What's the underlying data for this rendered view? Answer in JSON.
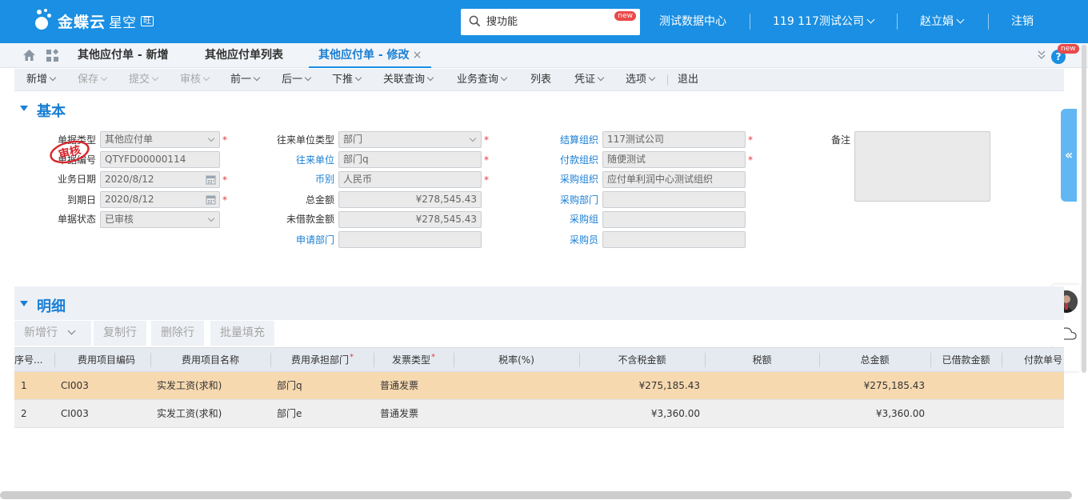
{
  "topbar": {
    "logo_text": "金蝶云",
    "logo_sub": "星空",
    "logo_tag": "旺",
    "search_placeholder": "搜功能",
    "search_badge": "new",
    "data_center": "测试数据中心",
    "company": "119 117测试公司",
    "user": "赵立娟",
    "logout": "注销",
    "brand_color": "#1a8fe3"
  },
  "tabs": [
    {
      "label": "其他应付单 - 新增",
      "active": false
    },
    {
      "label": "其他应付单列表",
      "active": false
    },
    {
      "label": "其他应付单 - 修改",
      "active": true
    }
  ],
  "tab_close": "×",
  "help_badge": "new",
  "help_label": "?",
  "toolbar": {
    "items": [
      {
        "label": "新增",
        "disabled": false
      },
      {
        "label": "保存",
        "disabled": true
      },
      {
        "label": "提交",
        "disabled": true
      },
      {
        "label": "审核",
        "disabled": true
      },
      {
        "label": "前一",
        "disabled": false
      },
      {
        "label": "后一",
        "disabled": false
      },
      {
        "label": "下推",
        "disabled": false
      },
      {
        "label": "关联查询",
        "disabled": false
      },
      {
        "label": "业务查询",
        "disabled": false
      },
      {
        "label": "列表",
        "disabled": false
      },
      {
        "label": "凭证",
        "disabled": false
      },
      {
        "label": "选项",
        "disabled": false
      },
      {
        "label": "退出",
        "disabled": false
      }
    ]
  },
  "basic": {
    "title": "基本",
    "stamp": "审核",
    "col1": {
      "bill_type": {
        "label": "单据类型",
        "value": "其他应付单",
        "required": true
      },
      "bill_no": {
        "label": "单据编号",
        "value": "QTYFD00000114",
        "required": false
      },
      "biz_date": {
        "label": "业务日期",
        "value": "2020/8/12",
        "required": true
      },
      "due_date": {
        "label": "到期日",
        "value": "2020/8/12",
        "required": true
      },
      "status": {
        "label": "单据状态",
        "value": "已审核",
        "required": false
      }
    },
    "col2": {
      "contact_type": {
        "label": "往来单位类型",
        "value": "部门",
        "required": true
      },
      "contact_unit": {
        "label": "往来单位",
        "value": "部门q",
        "required": true
      },
      "currency": {
        "label": "币别",
        "value": "人民币",
        "required": true
      },
      "total": {
        "label": "总金额",
        "value": "¥278,545.43"
      },
      "unborrowed": {
        "label": "未借款金额",
        "value": "¥278,545.43"
      },
      "apply_dept": {
        "label": "申请部门",
        "value": ""
      }
    },
    "col3": {
      "settle_org": {
        "label": "结算组织",
        "value": "117测试公司",
        "required": true
      },
      "pay_org": {
        "label": "付款组织",
        "value": "随便测试",
        "required": true
      },
      "purchase_org": {
        "label": "采购组织",
        "value": "应付单利润中心测试组织"
      },
      "purchase_dept": {
        "label": "采购部门",
        "value": ""
      },
      "purchase_group": {
        "label": "采购组",
        "value": ""
      },
      "purchaser": {
        "label": "采购员",
        "value": ""
      }
    },
    "remark": {
      "label": "备注",
      "value": ""
    }
  },
  "side_collapse": "«",
  "detail": {
    "title": "明细",
    "buttons": [
      {
        "label": "新增行"
      },
      {
        "label": "复制行"
      },
      {
        "label": "删除行"
      },
      {
        "label": "批量填充"
      }
    ],
    "columns": [
      {
        "label": "序号...",
        "required": false
      },
      {
        "label": "费用项目编码",
        "required": false
      },
      {
        "label": "费用项目名称",
        "required": false
      },
      {
        "label": "费用承担部门",
        "required": true
      },
      {
        "label": "发票类型",
        "required": true
      },
      {
        "label": "税率(%)",
        "required": false
      },
      {
        "label": "不含税金额",
        "required": false
      },
      {
        "label": "税额",
        "required": false
      },
      {
        "label": "总金额",
        "required": false
      },
      {
        "label": "已借款金额",
        "required": false
      },
      {
        "label": "付款单号",
        "required": false
      }
    ],
    "rows": [
      {
        "seq": "1",
        "code": "CI003",
        "name": "实发工资(求和)",
        "dept": "部门q",
        "invoice": "普通发票",
        "rate": "",
        "amount_ex": "¥275,185.43",
        "tax": "",
        "total": "¥275,185.43",
        "borrowed": "",
        "pay_no": "",
        "selected": true
      },
      {
        "seq": "2",
        "code": "CI003",
        "name": "实发工资(求和)",
        "dept": "部门e",
        "invoice": "普通发票",
        "rate": "",
        "amount_ex": "¥3,360.00",
        "tax": "",
        "total": "¥3,360.00",
        "borrowed": "",
        "pay_no": "",
        "selected": false
      }
    ]
  }
}
